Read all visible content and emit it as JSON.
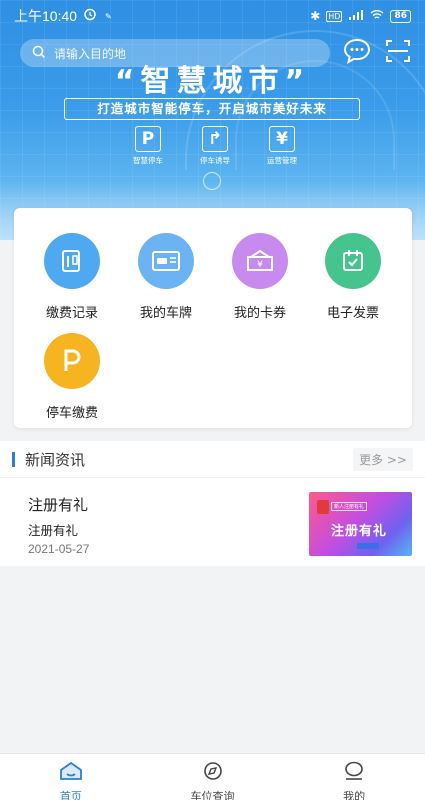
{
  "status_bar": {
    "time": "上午10:40",
    "battery": "86"
  },
  "search": {
    "placeholder": "请输入目的地"
  },
  "banner": {
    "slogan": "“智慧城市”",
    "subtitle": "打造城市智能停车，开启城市美好未来",
    "features": [
      {
        "glyph": "P",
        "label": "智慧停车",
        "icon": "parking-icon"
      },
      {
        "glyph": "↱",
        "label": "停车诱导",
        "icon": "direction-icon"
      },
      {
        "glyph": "¥",
        "label": "运营管理",
        "icon": "yuan-icon"
      }
    ]
  },
  "functions": [
    {
      "label": "缴费记录",
      "icon": "payment-record-icon",
      "color": "#4ea9f0"
    },
    {
      "label": "我的车牌",
      "icon": "license-plate-icon",
      "color": "#6bb3f2"
    },
    {
      "label": "我的卡券",
      "icon": "coupon-icon",
      "color": "#c98af0"
    },
    {
      "label": "电子发票",
      "icon": "invoice-icon",
      "color": "#45c58d"
    },
    {
      "label": "停车缴费",
      "icon": "parking-pay-icon",
      "color": "#f6b421"
    }
  ],
  "news": {
    "section_title": "新闻资讯",
    "more_label": "更多 >>",
    "items": [
      {
        "title": "注册有礼",
        "summary": "注册有礼",
        "date": "2021-05-27",
        "thumb_text": "注册有礼",
        "thumb_tag": "新人注册有礼"
      }
    ]
  },
  "tabbar": {
    "tabs": [
      {
        "label": "首页",
        "icon": "home-icon",
        "active": true
      },
      {
        "label": "车位查询",
        "icon": "compass-icon",
        "active": false
      },
      {
        "label": "我的",
        "icon": "profile-icon",
        "active": false
      }
    ]
  },
  "colors": {
    "accent": "#2d7fd3",
    "hero": "#3a9cea"
  }
}
